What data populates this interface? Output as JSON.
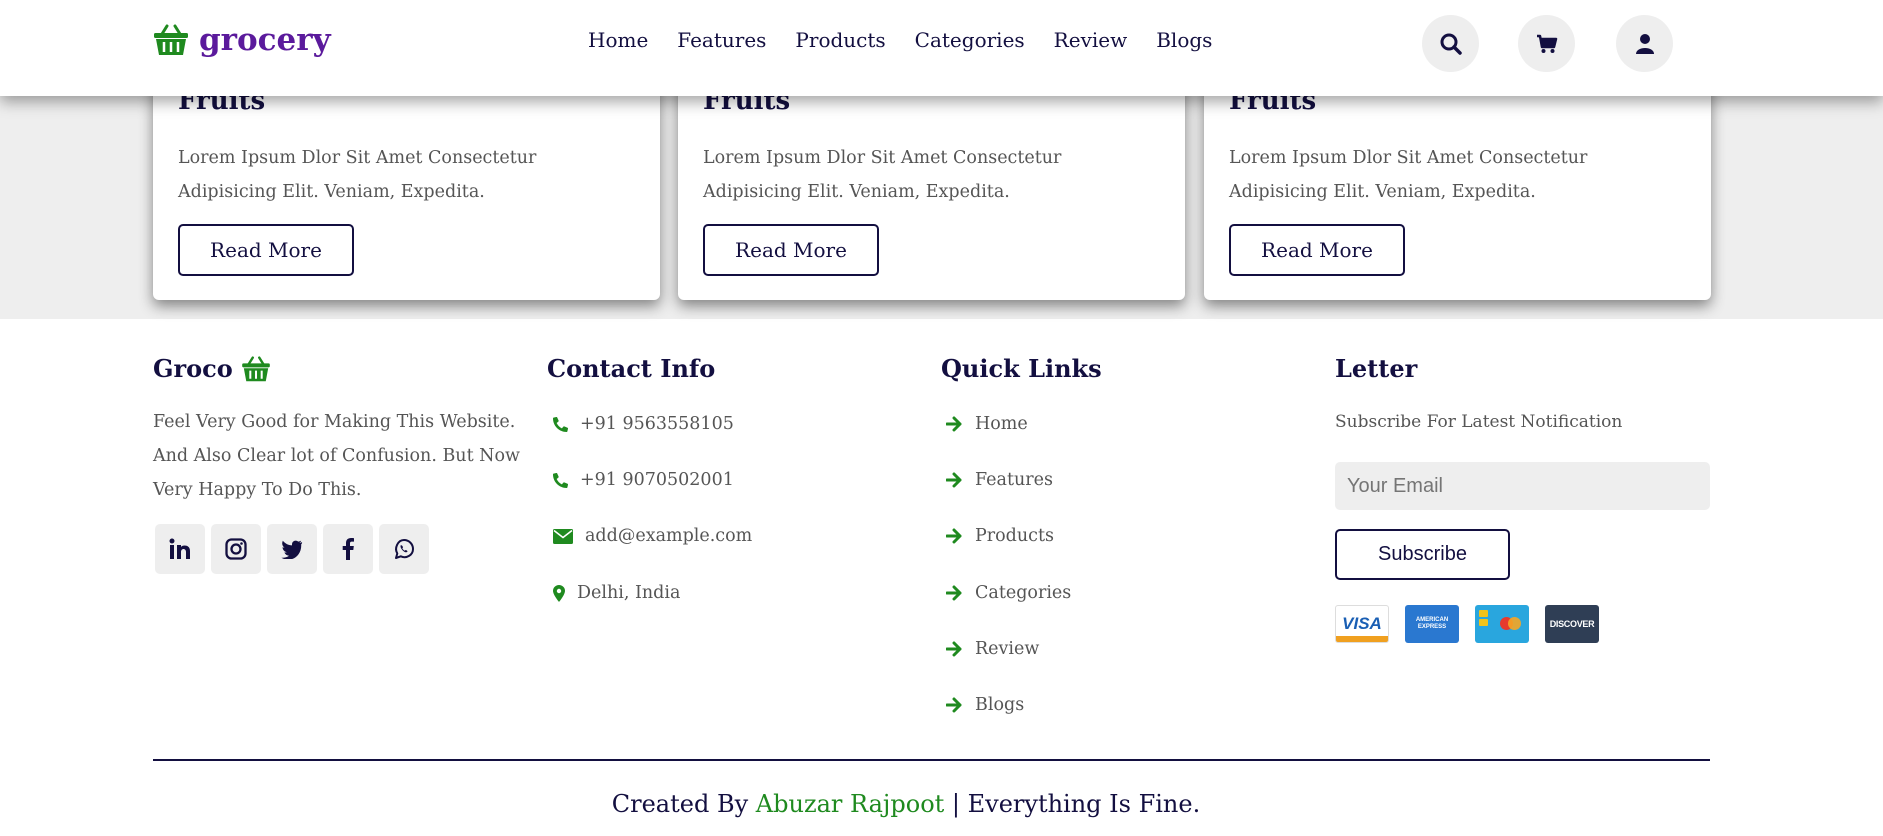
{
  "header": {
    "logo_text": "grocery",
    "nav": [
      "Home",
      "Features",
      "Products",
      "Categories",
      "Review",
      "Blogs"
    ],
    "icons": [
      "search-icon",
      "cart-icon",
      "user-icon"
    ]
  },
  "blog_cards": [
    {
      "title": "Fruits",
      "text": "Lorem Ipsum Dlor Sit Amet Consectetur Adipisicing Elit. Veniam, Expedita.",
      "button": "Read More"
    },
    {
      "title": "Fruits",
      "text": "Lorem Ipsum Dlor Sit Amet Consectetur Adipisicing Elit. Veniam, Expedita.",
      "button": "Read More"
    },
    {
      "title": "Fruits",
      "text": "Lorem Ipsum Dlor Sit Amet Consectetur Adipisicing Elit. Veniam, Expedita.",
      "button": "Read More"
    }
  ],
  "footer": {
    "brand": {
      "title": "Groco",
      "description": "Feel Very Good for Making This Website. And Also Clear lot of Confusion. But Now Very Happy To Do This.",
      "social": [
        "linkedin-icon",
        "instagram-icon",
        "twitter-icon",
        "facebook-icon",
        "whatsapp-icon"
      ]
    },
    "contact": {
      "title": "Contact Info",
      "phone1": "+91 9563558105",
      "phone2": "+91 9070502001",
      "email": "add@example.com",
      "location": "Delhi, India"
    },
    "quick_links": {
      "title": "Quick Links",
      "items": [
        "Home",
        "Features",
        "Products",
        "Categories",
        "Review",
        "Blogs"
      ]
    },
    "newsletter": {
      "title": "Letter",
      "subtitle": "Subscribe For Latest Notification",
      "placeholder": "Your Email",
      "button": "Subscribe",
      "payment": [
        "VISA",
        "AMERICAN EXPRESS",
        "mastercard",
        "DISCOVER"
      ]
    },
    "credit": {
      "prefix": "Created By",
      "name": "Abuzar Rajpoot",
      "suffix": "| Everything Is Fine."
    }
  },
  "colors": {
    "primary": "#130f40",
    "accent_green": "#1f8a1f",
    "logo_purple": "#5b1a9c",
    "band_gray": "#eeeeee"
  }
}
